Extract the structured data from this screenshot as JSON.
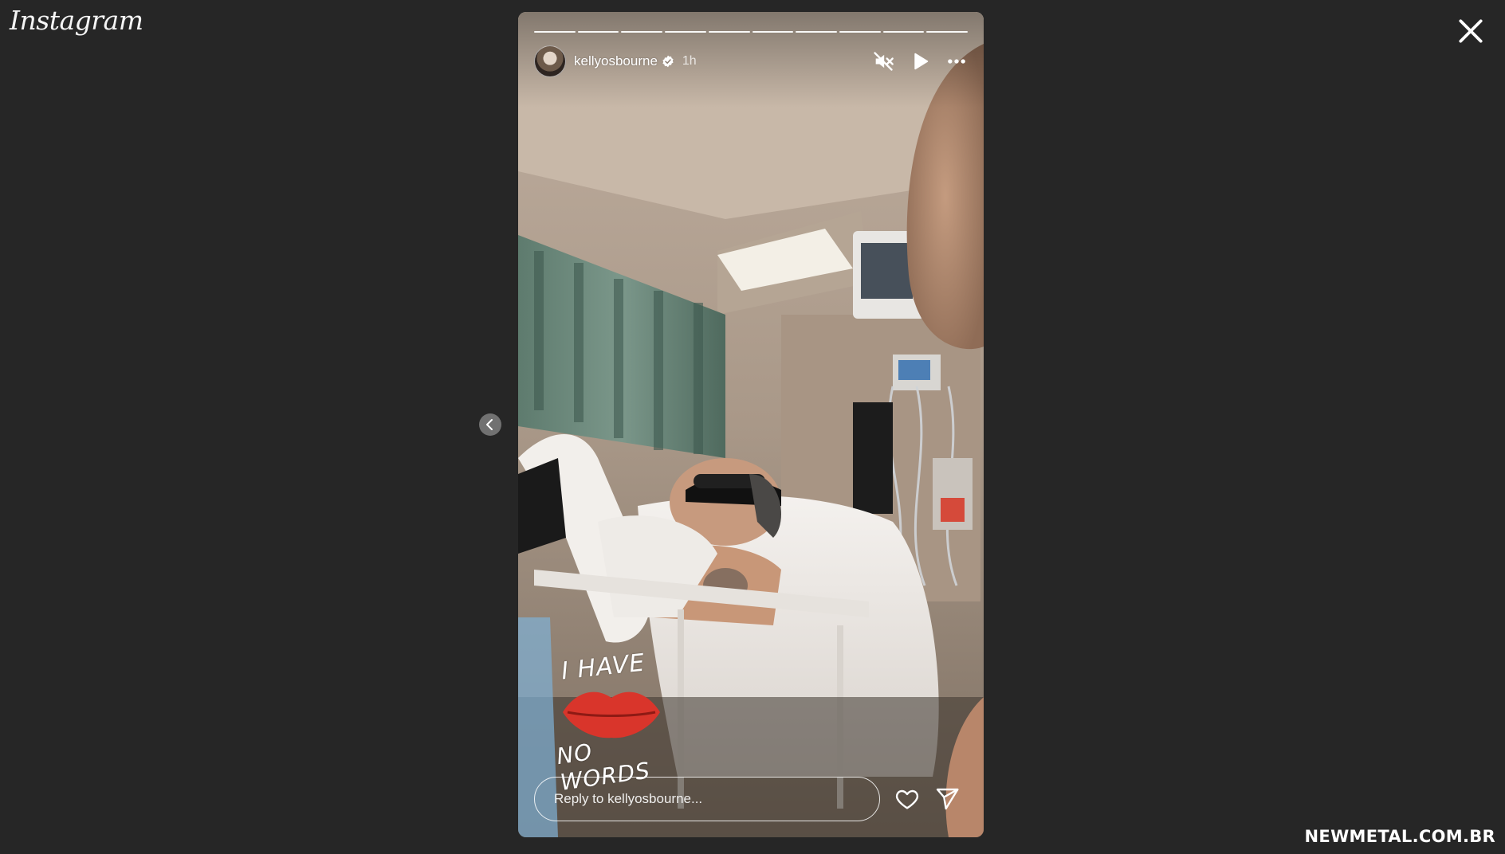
{
  "app": {
    "logo_text": "Instagram"
  },
  "story": {
    "username": "kellyosbourne",
    "verified": true,
    "time_ago": "1h",
    "progress_segments": 10,
    "sticker": {
      "top_text": "I HAVE",
      "bottom_text": "NO WORDS",
      "lips_color": "#d9352b"
    }
  },
  "reply": {
    "placeholder": "Reply to kellyosbourne..."
  },
  "icons": {
    "close": "close-icon",
    "mute": "speaker-muted-icon",
    "play": "play-icon",
    "more": "more-options-icon",
    "prev": "chevron-left-icon",
    "like": "heart-icon",
    "share": "send-icon",
    "verified": "verified-badge-icon"
  },
  "watermark": "NEWMETAL.COM.BR",
  "colors": {
    "page_background": "#262626",
    "text_primary": "#ffffff",
    "verified_badge": "#ffffff"
  }
}
